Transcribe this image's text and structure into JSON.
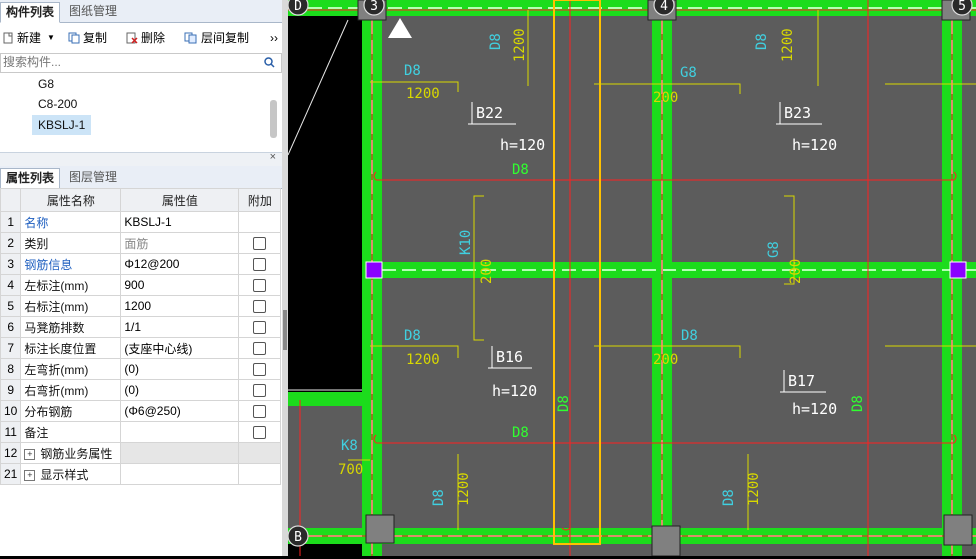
{
  "top_panel": {
    "tabs": [
      {
        "label": "构件列表",
        "active": true
      },
      {
        "label": "图纸管理",
        "active": false
      }
    ],
    "toolbar": {
      "new_label": "新建",
      "copy_label": "复制",
      "delete_label": "删除",
      "layer_copy_label": "层间复制",
      "more_label": "››"
    },
    "search_placeholder": "搜索构件...",
    "components": [
      "G8",
      "C8-200",
      "KBSLJ-1"
    ],
    "selected_component": "KBSLJ-1"
  },
  "bottom_panel": {
    "tabs": [
      {
        "label": "属性列表",
        "active": true
      },
      {
        "label": "图层管理",
        "active": false
      }
    ],
    "headers": {
      "name": "属性名称",
      "value": "属性值",
      "extra": "附加"
    },
    "rows": [
      {
        "n": "1",
        "name": "名称",
        "value": "KBSLJ-1"
      },
      {
        "n": "2",
        "name": "类别",
        "value": "面筋"
      },
      {
        "n": "3",
        "name": "钢筋信息",
        "value": "Φ12@200"
      },
      {
        "n": "4",
        "name": "左标注(mm)",
        "value": "900"
      },
      {
        "n": "5",
        "name": "右标注(mm)",
        "value": "1200"
      },
      {
        "n": "6",
        "name": "马凳筋排数",
        "value": "1/1"
      },
      {
        "n": "7",
        "name": "标注长度位置",
        "value": "(支座中心线)"
      },
      {
        "n": "8",
        "name": "左弯折(mm)",
        "value": "(0)"
      },
      {
        "n": "9",
        "name": "右弯折(mm)",
        "value": "(0)"
      },
      {
        "n": "10",
        "name": "分布钢筋",
        "value": "(Φ6@250)"
      },
      {
        "n": "11",
        "name": "备注",
        "value": ""
      },
      {
        "n": "12",
        "name": "钢筋业务属性",
        "value": ""
      },
      {
        "n": "21",
        "name": "显示样式",
        "value": ""
      }
    ]
  },
  "drawing": {
    "axis_labels": [
      "3",
      "4",
      "5",
      "D",
      "B"
    ],
    "slab_labels": [
      "B22",
      "B23",
      "B16",
      "B17"
    ],
    "thickness_label": "h=120",
    "rebar_labels": {
      "d8": "D8",
      "g8": "G8",
      "k10": "K10",
      "k8": "K8",
      "n1200": "1200",
      "n700": "700",
      "n200": "200"
    },
    "colors": {
      "background": "#000000",
      "slab": "#5c5c5c",
      "beam": "#1cdc1c",
      "axis": "#ff2020",
      "selection": "#ffc000",
      "text_blue": "#40d0e0",
      "text_green": "#30ff30",
      "text_white": "#ffffff",
      "column_purple": "#8a00ff"
    }
  }
}
